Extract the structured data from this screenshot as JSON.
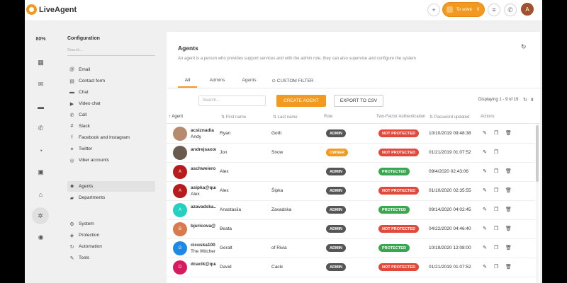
{
  "app": {
    "logo_text": "LiveAgent",
    "zoom": "80%"
  },
  "topbar": {
    "to_solve_label": "To solve",
    "to_solve_count": "0",
    "user_initial": "A"
  },
  "config": {
    "title": "Configuration",
    "search_placeholder": "Search...",
    "items": [
      {
        "label": "Email",
        "icon": "at-icon"
      },
      {
        "label": "Contact form",
        "icon": "form-icon"
      },
      {
        "label": "Chat",
        "icon": "chat-icon"
      },
      {
        "label": "Video chat",
        "icon": "video-icon"
      },
      {
        "label": "Call",
        "icon": "phone-icon"
      },
      {
        "label": "Slack",
        "icon": "slack-icon"
      },
      {
        "label": "Facebook and Instagram",
        "icon": "facebook-icon"
      },
      {
        "label": "Twitter",
        "icon": "twitter-icon"
      },
      {
        "label": "Viber accounts",
        "icon": "viber-icon"
      },
      {
        "label": "Agents",
        "icon": "agents-icon"
      },
      {
        "label": "Departments",
        "icon": "folder-icon"
      },
      {
        "label": "System",
        "icon": "system-icon"
      },
      {
        "label": "Protection",
        "icon": "shield-icon"
      },
      {
        "label": "Automation",
        "icon": "automation-icon"
      },
      {
        "label": "Tools",
        "icon": "wrench-icon"
      }
    ]
  },
  "main": {
    "title": "Agents",
    "description": "An agent is a person who provides support services and with the admin role, they can also supervise and configure the system",
    "tabs": [
      "All",
      "Admins",
      "Agents",
      "CUSTOM FILTER"
    ],
    "search_placeholder": "Search...",
    "create_label": "CREATE AGENT",
    "export_label": "EXPORT TO CSV",
    "displaying": "Displaying 1 - 9 of 19",
    "columns": [
      "Agent",
      "First name",
      "Last name",
      "Role",
      "Two-Factor Authentication",
      "Password updated",
      "Actions"
    ]
  },
  "rows": [
    {
      "user": "acsiznadia",
      "sub": "Andy",
      "first": "Ryan",
      "last": "Goth",
      "role": "ADMIN",
      "tfa": "NOT PROTECTED",
      "updated": "10/10/2019 09:48:38",
      "avatar": "",
      "avatar_color": "#b58a6f"
    },
    {
      "user": "andrejsaxon",
      "sub": "",
      "first": "Jon",
      "last": "Snow",
      "role": "OWNER",
      "tfa": "NOT PROTECTED",
      "updated": "01/21/2019 01:07:52",
      "avatar": "",
      "avatar_color": "#6b5a4e"
    },
    {
      "user": "aschweiero",
      "sub": "",
      "first": "Alex",
      "last": "",
      "role": "ADMIN",
      "tfa": "PROTECTED",
      "updated": "09/4/2020 02:43:06",
      "avatar": "A",
      "avatar_color": "#b71c1c"
    },
    {
      "user": "asipka@qua",
      "sub": "Alex",
      "first": "Alex",
      "last": "Šipka",
      "role": "ADMIN",
      "tfa": "NOT PROTECTED",
      "updated": "01/10/2020 02:35:55",
      "avatar": "A",
      "avatar_color": "#b71c1c"
    },
    {
      "user": "azavadska...",
      "sub": "",
      "first": "Anastasiia",
      "last": "Zavadska",
      "role": "ADMIN",
      "tfa": "PROTECTED",
      "updated": "09/14/2020 04:02:45",
      "avatar": "A",
      "avatar_color": "#26d0c0"
    },
    {
      "user": "bjuricova@",
      "sub": "",
      "first": "Beata",
      "last": "",
      "role": "ADMIN",
      "tfa": "NOT PROTECTED",
      "updated": "04/22/2020 04:46:40",
      "avatar": "B",
      "avatar_color": "#d97a4e"
    },
    {
      "user": "cicuska100",
      "sub": "The Witcher",
      "first": "Geralt",
      "last": "of Rivia",
      "role": "ADMIN",
      "tfa": "PROTECTED",
      "updated": "10/19/2020 12:08:00",
      "avatar": "G",
      "avatar_color": "#1e88e5"
    },
    {
      "user": "dcacik@qua",
      "sub": "",
      "first": "David",
      "last": "Cacik",
      "role": "ADMIN",
      "tfa": "NOT PROTECTED",
      "updated": "01/21/2019 01:07:52",
      "avatar": "D",
      "avatar_color": "#d81b60"
    }
  ]
}
